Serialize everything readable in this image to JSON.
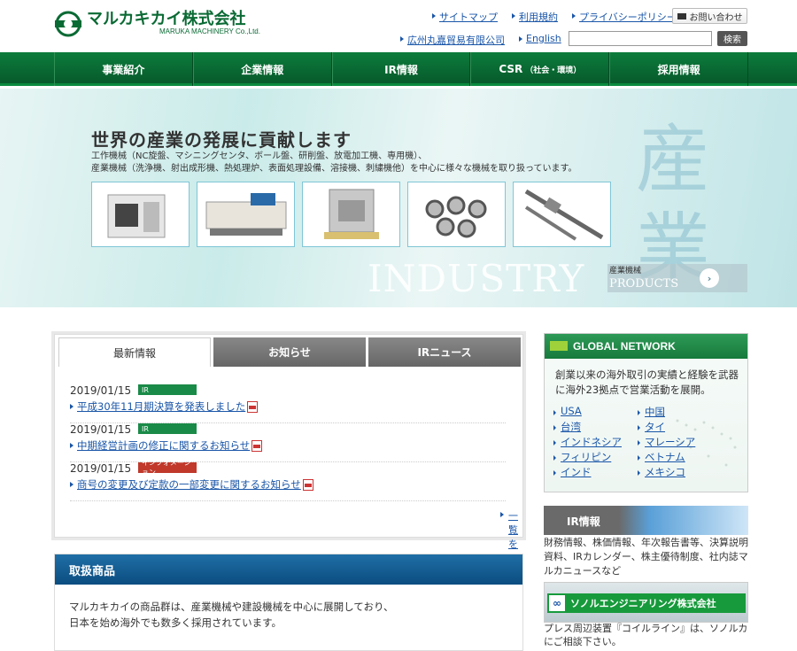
{
  "header": {
    "logo_jp": "マルカキカイ株式会社",
    "logo_en": "MARUKA MACHINERY Co.,Ltd.",
    "links_top": [
      "サイトマップ",
      "利用規約",
      "プライバシーポリシー"
    ],
    "contact": "お問い合わせ",
    "links_bottom": [
      "広州丸嘉貿易有限公司",
      "English"
    ],
    "search_button": "検索",
    "search_placeholder": ""
  },
  "nav": {
    "items": [
      "事業紹介",
      "企業情報",
      "IR情報",
      "CSR",
      "採用情報"
    ],
    "csr_sub": "（社会・環境）"
  },
  "hero": {
    "kanji": "産\n業",
    "title": "世界の産業の発展に貢献します",
    "desc1": "工作機械（NC旋盤、マシニングセンタ、ボール盤、研削盤、放電加工機、専用機）、",
    "desc2": "産業機械（洗浄機、射出成形機、熱処理炉、表面処理設備、溶接機、刺繍機他）を中心に様々な機械を取り扱っています。",
    "industry": "INDUSTRY",
    "industry_jp": "産業機械",
    "industry_en": "PRODUCTS",
    "arrow": "›"
  },
  "news": {
    "tabs": [
      "最新情報",
      "お知らせ",
      "IRニュース"
    ],
    "items": [
      {
        "date": "2019/01/15",
        "badge": "IR",
        "title": "平成30年11月期決算を発表しました"
      },
      {
        "date": "2019/01/15",
        "badge": "IR",
        "title": "中期経営計画の修正に関するお知らせ"
      },
      {
        "date": "2019/01/15",
        "badge": "インフォメーション",
        "title": "商号の変更及び定款の一部変更に関するお知らせ"
      }
    ],
    "more": "一覧を見る"
  },
  "products": {
    "heading": "取扱商品",
    "text1": "マルカキカイの商品群は、産業機械や建設機械を中心に展開しており、",
    "text2": "日本を始め海外でも数多く採用されています。"
  },
  "global": {
    "heading": "GLOBAL NETWORK",
    "text": "創業以来の海外取引の実績と経験を武器に海外23拠点で営業活動を展開。",
    "regions": [
      "USA",
      "中国",
      "台湾",
      "タイ",
      "インドネシア",
      "マレーシア",
      "フィリピン",
      "ベトナム",
      "インド",
      "メキシコ"
    ]
  },
  "ir": {
    "heading": "IR情報",
    "text": "財務情報、株価情報、年次報告書等、決算説明資料、IRカレンダー、株主優待制度、社内誌マルカニュースなど"
  },
  "sonol": {
    "name": "ソノルエンジニアリング株式会社",
    "text": "プレス周辺装置『コイルライン』は、ソノルカにご相談下さい。"
  }
}
